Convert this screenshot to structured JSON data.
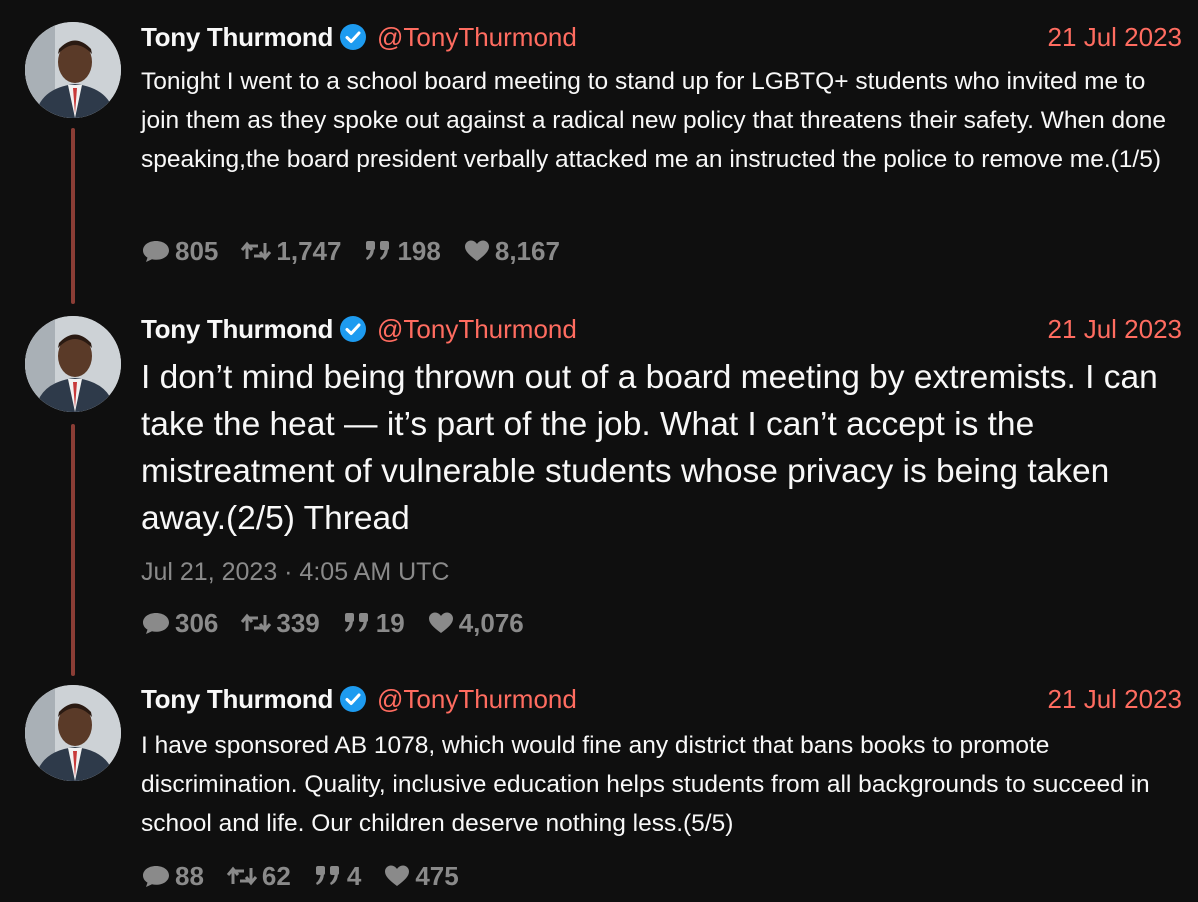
{
  "colors": {
    "background": "#0f0f0f",
    "accent": "#ff6c60",
    "text": "#f8f8f8",
    "muted": "#8a8a8a",
    "thread_line": "#8a3d35",
    "verified": "#1d9bf0"
  },
  "tweets": [
    {
      "author_name": "Tony Thurmond",
      "handle": "@TonyThurmond",
      "date": "21 Jul 2023",
      "text": "Tonight I went to a school board meeting to stand up for LGBTQ+ students who invited me to join them as they spoke out against a radical new policy that threatens their safety. When done speaking,the board president verbally attacked me an instructed the police to remove me.(1/5)",
      "stats": {
        "replies": "805",
        "retweets": "1,747",
        "quotes": "198",
        "likes": "8,167"
      }
    },
    {
      "author_name": "Tony Thurmond",
      "handle": "@TonyThurmond",
      "date": "21 Jul 2023",
      "text": "I don’t mind being thrown out of a board meeting by extremists. I can take the heat — it’s part of the job. What I can’t accept is the mistreatment of vulnerable students whose privacy is being taken away.(2/5) Thread",
      "published": "Jul 21, 2023 · 4:05 AM UTC",
      "stats": {
        "replies": "306",
        "retweets": "339",
        "quotes": "19",
        "likes": "4,076"
      }
    },
    {
      "author_name": "Tony Thurmond",
      "handle": "@TonyThurmond",
      "date": "21 Jul 2023",
      "text": "I have sponsored AB 1078, which would fine any district that bans books to promote discrimination. Quality, inclusive education helps students from all backgrounds to succeed in school and life. Our children deserve nothing less.(5/5)",
      "stats": {
        "replies": "88",
        "retweets": "62",
        "quotes": "4",
        "likes": "475"
      }
    }
  ]
}
